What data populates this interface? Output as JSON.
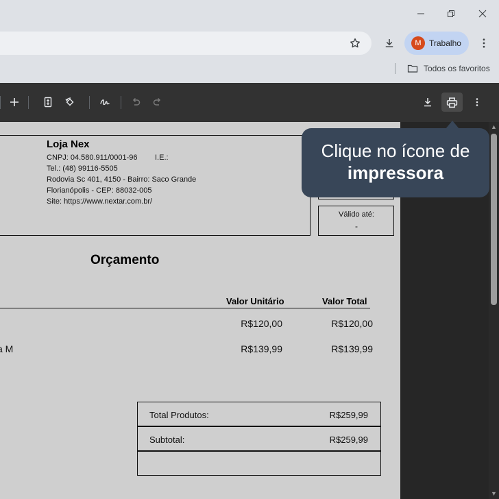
{
  "profile": {
    "initial": "M",
    "label": "Trabalho"
  },
  "bookmarks": {
    "all_label": "Todos os favoritos"
  },
  "pdf_toolbar": {
    "icons": [
      "plus-icon",
      "fit-page-icon",
      "rotate-icon",
      "draw-icon",
      "undo-icon",
      "redo-icon",
      "download-icon",
      "print-icon",
      "more-icon"
    ]
  },
  "document": {
    "store_name": "Loja Nex",
    "cnpj": "CNPJ: 04.580.911/0001-96",
    "ie": "I.E.:",
    "phone": "Tel.: (48) 99116-5505",
    "address": "Rodovia Sc 401, 4150 - Bairro: Saco Grande",
    "city": "Florianópolis - CEP: 88032-005",
    "site": "Site: https://www.nextar.com.br/",
    "valid_until_label": "Válido até:",
    "valid_until_value": "-",
    "title": "Orçamento",
    "columns": {
      "unit": "Valor Unitário",
      "total": "Valor Total"
    },
    "rows": [
      {
        "name": "",
        "unit": "R$120,00",
        "total": "R$120,00"
      },
      {
        "name": "a M",
        "unit": "R$139,99",
        "total": "R$139,99"
      }
    ],
    "totals": [
      {
        "label": "Total Produtos:",
        "value": "R$259,99"
      },
      {
        "label": "Subtotal:",
        "value": "R$259,99"
      }
    ]
  },
  "tooltip": {
    "line1": "Clique no ícone de",
    "line2": "impressora"
  },
  "colors": {
    "tooltip_bg": "#384658",
    "pdf_toolbar_bg": "#323232",
    "avatar_bg": "#d64a1c",
    "profile_chip_bg": "#c2d4f2"
  }
}
